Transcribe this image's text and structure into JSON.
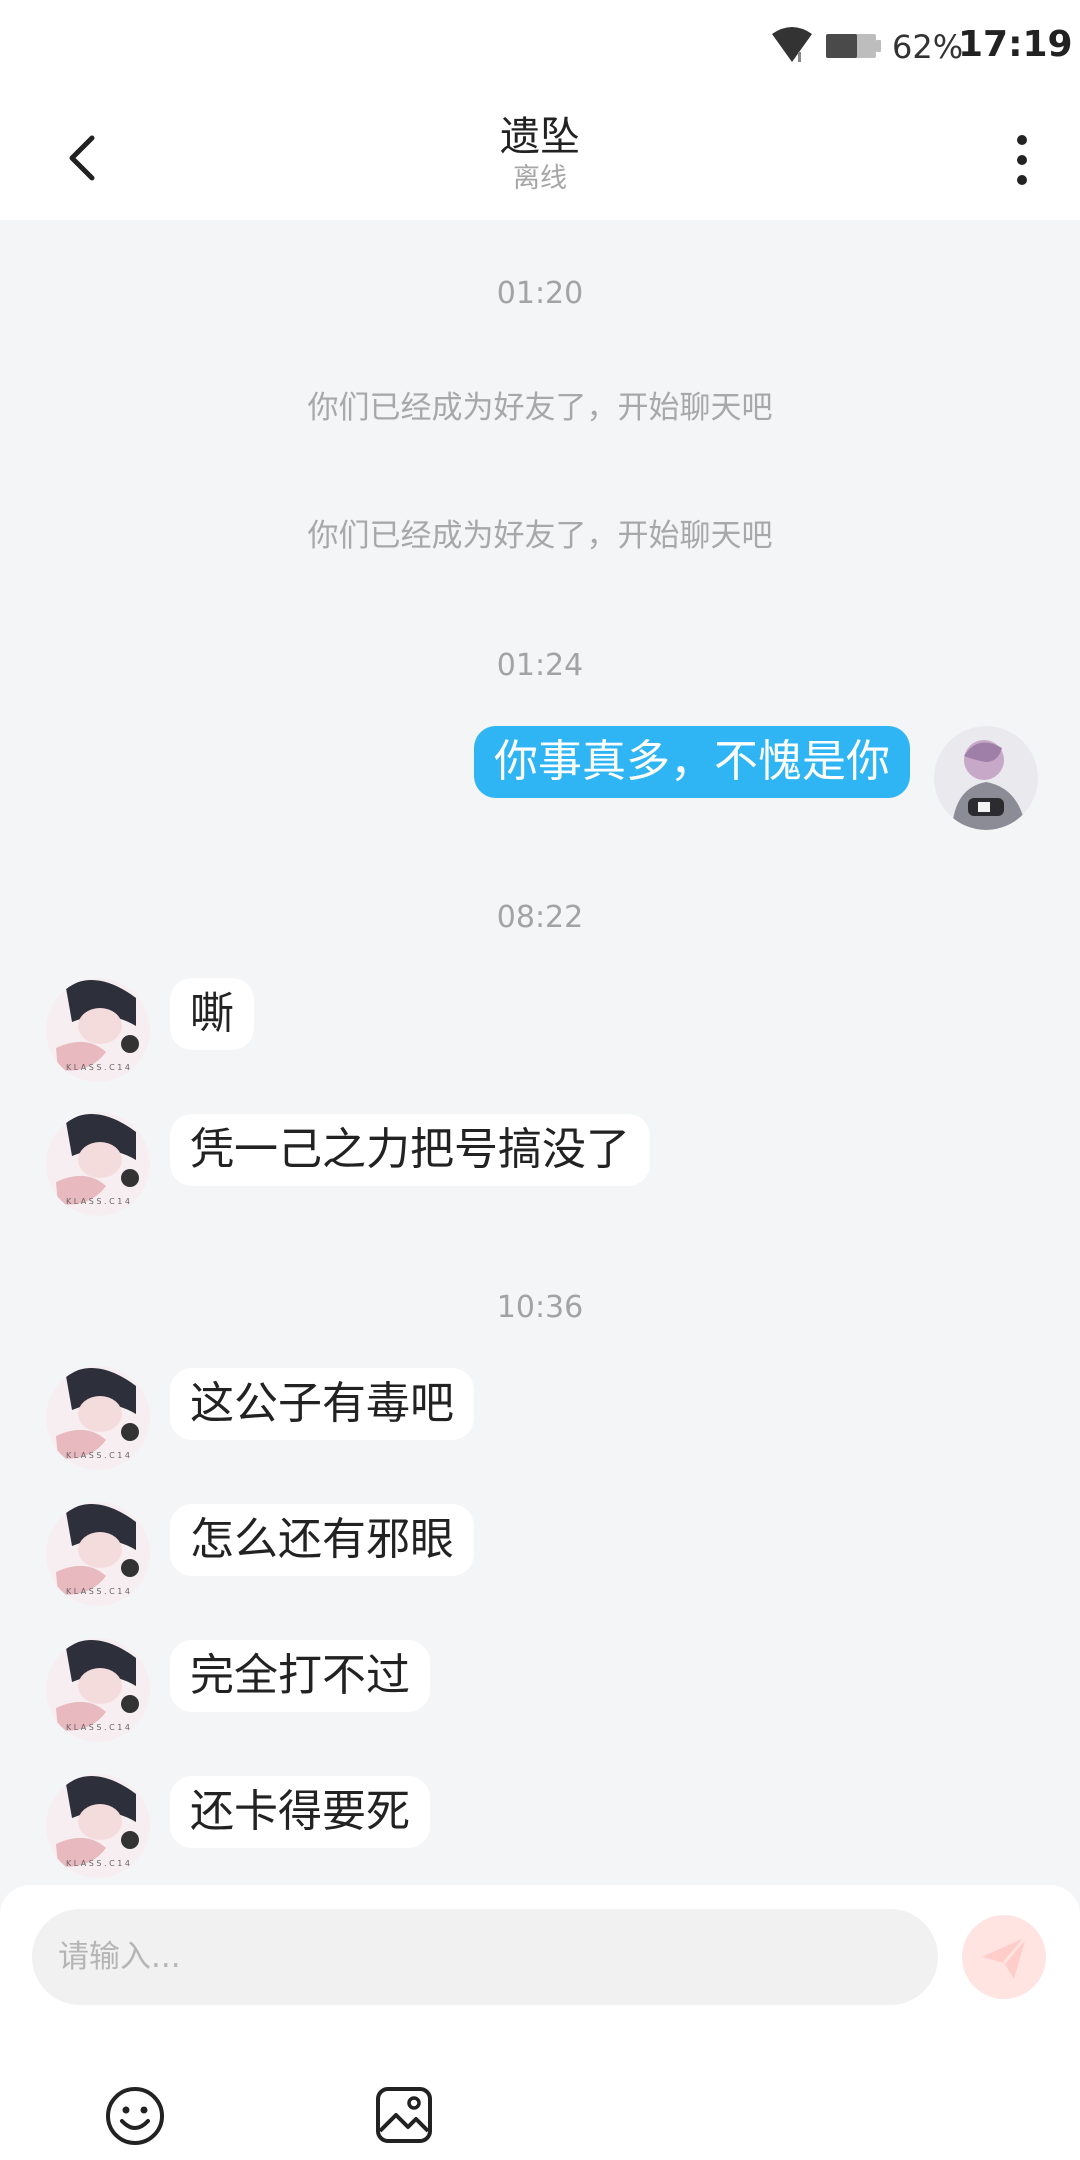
{
  "status_bar": {
    "battery_percent": "62%",
    "time": "17:19",
    "wifi_icon": "wifi-icon",
    "battery_icon": "battery-icon"
  },
  "header": {
    "title": "遗坠",
    "status": "离线",
    "back_icon": "chevron-left-icon",
    "more_icon": "more-vertical-icon"
  },
  "messages": [
    {
      "type": "time",
      "text": "01:20"
    },
    {
      "type": "system",
      "text": "你们已经成为好友了，开始聊天吧"
    },
    {
      "type": "system",
      "text": "你们已经成为好友了，开始聊天吧"
    },
    {
      "type": "time",
      "text": "01:24"
    },
    {
      "type": "outgoing",
      "text": "你事真多，不愧是你"
    },
    {
      "type": "time",
      "text": "08:22"
    },
    {
      "type": "incoming",
      "text": "嘶"
    },
    {
      "type": "incoming",
      "text": "凭一己之力把号搞没了"
    },
    {
      "type": "time",
      "text": "10:36"
    },
    {
      "type": "incoming",
      "text": "这公子有毒吧"
    },
    {
      "type": "incoming",
      "text": "怎么还有邪眼"
    },
    {
      "type": "incoming",
      "text": "完全打不过"
    },
    {
      "type": "incoming",
      "text": "还卡得要死"
    }
  ],
  "avatar_text": "K L A S S . C 1 4",
  "composer": {
    "placeholder": "请输入...",
    "send_icon": "send-icon",
    "emoji_icon": "emoji-icon",
    "image_icon": "image-icon"
  },
  "colors": {
    "outgoing_bubble": "#2fb5f4",
    "incoming_bubble": "#ffffff",
    "background": "#f4f5f7",
    "send_button": "#ffe4e2",
    "send_icon": "#ffcdc9"
  }
}
